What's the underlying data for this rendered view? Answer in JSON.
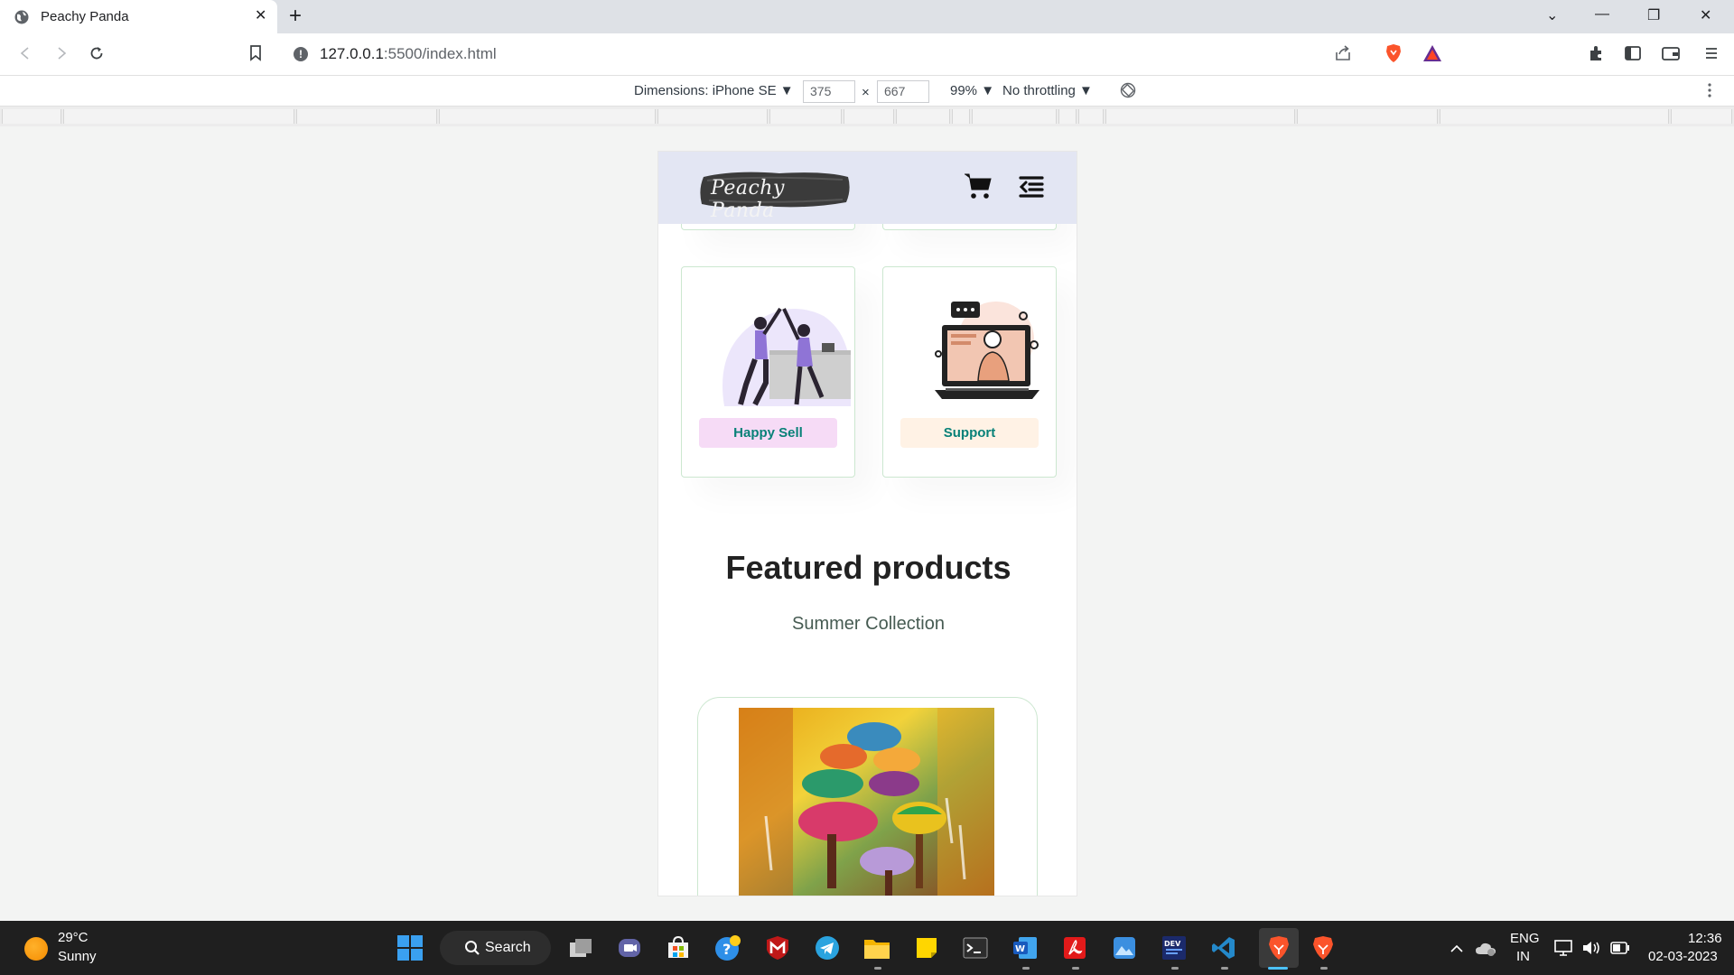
{
  "browser": {
    "tab_title": "Peachy Panda",
    "tab_close": "✕",
    "new_tab": "+",
    "url_host": "127.0.0.1",
    "url_path": ":5500/index.html",
    "window_controls": [
      "⌄",
      "—",
      "❐",
      "✕"
    ]
  },
  "devtools": {
    "dimensions_label": "Dimensions: iPhone SE ▼",
    "width": "375",
    "times": "×",
    "height": "667",
    "zoom": "99% ▼",
    "throttling": "No throttling ▼"
  },
  "site": {
    "logo_text": "Peachy Panda",
    "cards": [
      {
        "label": "Happy Sell",
        "label_bg": "#f6dbf6"
      },
      {
        "label": "Support",
        "label_bg": "#fff2e5"
      }
    ],
    "featured_title": "Featured products",
    "featured_subtitle": "Summer Collection",
    "header_bg": "#e3e6f3",
    "accent": "#088178"
  },
  "taskbar": {
    "temperature": "29°C",
    "weather": "Sunny",
    "search_label": "Search",
    "language_top": "ENG",
    "language_bottom": "IN",
    "time": "12:36",
    "date": "02-03-2023"
  }
}
